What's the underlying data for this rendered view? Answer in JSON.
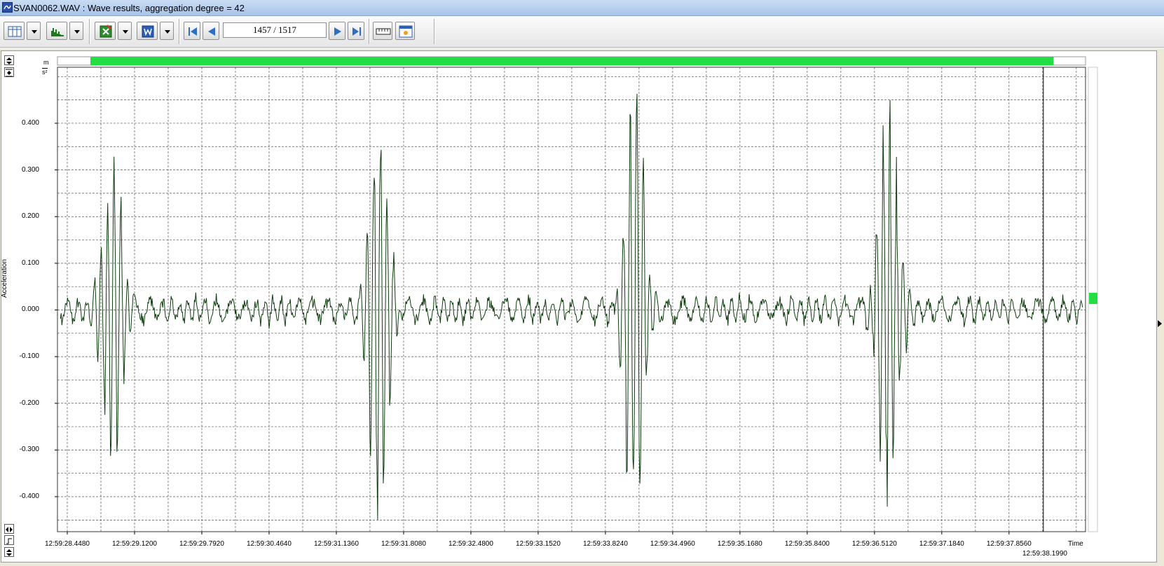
{
  "window": {
    "title": "SVAN0062.WAV : Wave results, aggregation degree = 42"
  },
  "toolbar": {
    "counter_value": "1457 / 1517",
    "buttons": [
      "table-view",
      "spectrum-view",
      "export-excel",
      "export-word",
      "first-record",
      "previous-record",
      "next-record",
      "last-record",
      "cursor-markers",
      "settings"
    ]
  },
  "colors": {
    "trace": "#0d3d0d",
    "progress": "#22dd44",
    "grid": "#333333",
    "titlebar": "#b8d0ef"
  },
  "chart_data": {
    "type": "line",
    "ylabel": "Acceleration",
    "xlabel": "Time",
    "unit_top": "m",
    "unit_bottom": "s²",
    "ylim": [
      -0.475,
      0.52
    ],
    "yticks": [
      "0.400",
      "0.300",
      "0.200",
      "0.100",
      "0.000",
      "-0.100",
      "-0.200",
      "-0.300",
      "-0.400"
    ],
    "ytick_values": [
      0.4,
      0.3,
      0.2,
      0.1,
      0.0,
      -0.1,
      -0.2,
      -0.3,
      -0.4
    ],
    "xticks": [
      "12:59:28.4480",
      "12:59:29.1200",
      "12:59:29.7920",
      "12:59:30.4640",
      "12:59:31.1360",
      "12:59:31.8080",
      "12:59:32.4800",
      "12:59:33.1520",
      "12:59:33.8240",
      "12:59:34.4960",
      "12:59:35.1680",
      "12:59:35.8400",
      "12:59:36.5120",
      "12:59:37.1840",
      "12:59:37.8560"
    ],
    "xtick_seconds": [
      28.448,
      29.12,
      29.792,
      30.464,
      31.136,
      31.808,
      32.48,
      33.152,
      33.824,
      34.496,
      35.168,
      35.84,
      36.512,
      37.184,
      37.856
    ],
    "end_time": "12:59:38.1990",
    "end_time_seconds": 38.199,
    "xlim_seconds": [
      28.35,
      38.62
    ],
    "progress_fraction": 0.968,
    "grid": true,
    "series": [
      {
        "events": [
          {
            "t": 28.9,
            "amp": 0.33,
            "min": -0.335,
            "max": 0.25
          },
          {
            "t": 31.56,
            "amp": 0.42,
            "min": -0.47,
            "max": 0.32
          },
          {
            "t": 34.12,
            "amp": 0.45,
            "min": -0.475,
            "max": 0.35
          },
          {
            "t": 36.65,
            "amp": 0.42,
            "min": -0.475,
            "max": 0.305
          }
        ],
        "baseline_amplitude": 0.022
      }
    ]
  }
}
